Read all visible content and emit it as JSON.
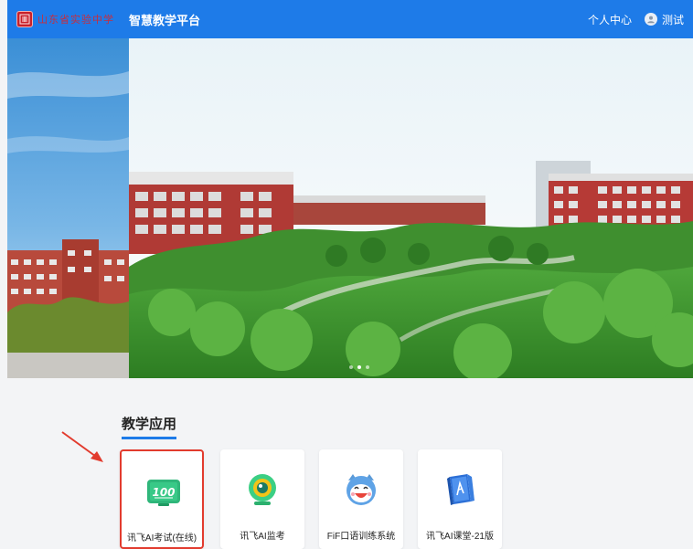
{
  "header": {
    "logo_text": "山东省实验中学",
    "platform_title": "智慧教学平台",
    "personal_center": "个人中心",
    "user_name": "测试"
  },
  "banner": {
    "slide_count": 3,
    "active_index": 1
  },
  "section": {
    "title": "教学应用"
  },
  "apps": [
    {
      "label": "讯飞AI考试(在线)",
      "icon": "exam-100-icon",
      "selected": true
    },
    {
      "label": "讯飞AI监考",
      "icon": "camera-icon",
      "selected": false
    },
    {
      "label": "FiF口语训练系统",
      "icon": "cartoon-face-icon",
      "selected": false
    },
    {
      "label": "讯飞AI课堂-21版",
      "icon": "book-icon",
      "selected": false
    }
  ],
  "colors": {
    "topbar": "#1e7be8",
    "accent": "#1e7be8",
    "highlight": "#e23b2e"
  }
}
